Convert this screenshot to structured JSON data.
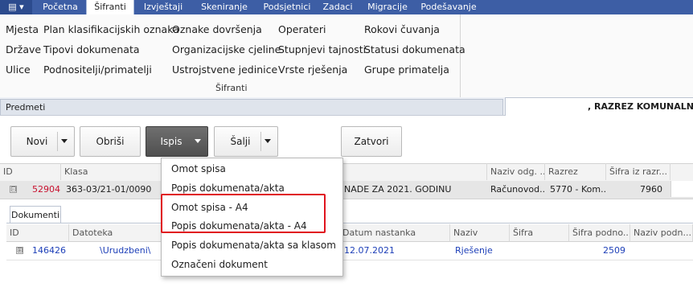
{
  "tabs": [
    {
      "label": "Početna"
    },
    {
      "label": "Šifranti",
      "active": true
    },
    {
      "label": "Izvještaji"
    },
    {
      "label": "Skeniranje"
    },
    {
      "label": "Podsjetnici"
    },
    {
      "label": "Zadaci"
    },
    {
      "label": "Migracije"
    },
    {
      "label": "Podešavanje"
    }
  ],
  "ribbon": {
    "group_label": "Šifranti",
    "col1": [
      "Mjesta",
      "Države",
      "Ulice"
    ],
    "col2": [
      "Plan klasifikacijskih oznaka",
      "Tipovi dokumenata",
      "Podnositelji/primatelji"
    ],
    "col3": [
      "Oznake dovršenja",
      "Organizacijske cjeline",
      "Ustrojstvene jedinice"
    ],
    "col4": [
      "Operateri",
      "Stupnjevi tajnosti",
      "Vrste rješenja"
    ],
    "col5": [
      "Rokovi čuvanja",
      "Statusi dokumenata",
      "Grupe primatelja"
    ]
  },
  "doc_tabs": {
    "predmeti": "Predmeti",
    "razrez": ", RAZREZ KOMUNALNE NA"
  },
  "toolbar": {
    "novi": "Novi",
    "obrisi": "Obriši",
    "ispis": "Ispis",
    "salji": "Šalji",
    "zatvori": "Zatvori"
  },
  "grid": {
    "headers": {
      "id": "ID",
      "klasa": "Klasa",
      "naziv_odg": "Naziv odg. ...",
      "razrez": "Razrez",
      "sifra_iz_razr": "Šifra iz razr..."
    },
    "row": {
      "expander": "⊟",
      "id": "52904",
      "klasa": "363-03/21-01/0090",
      "naziv": "NADE ZA 2021. GODINU",
      "naziv_odg": "Računovod...",
      "razrez": "5770 - Kom...",
      "sifra": "7960"
    }
  },
  "subgrid": {
    "tab": "Dokumenti",
    "headers": {
      "id": "ID",
      "datoteka": "Datoteka",
      "datum": "Datum nastanka",
      "naziv": "Naziv",
      "sifra": "Šifra",
      "sifra_podno": "Šifra podno...",
      "naziv_podn": "Naziv podn..."
    },
    "row": {
      "expander": "⊞",
      "id": "146426",
      "datoteka": "\\Urudzbeni\\",
      "datum": "12.07.2021",
      "naziv": "Rješenje",
      "sifra_podno": "2509"
    }
  },
  "dropdown": {
    "items": [
      "Omot spisa",
      "Popis dokumenata/akta",
      "Omot spisa - A4",
      "Popis dokumenata/akta - A4",
      "Popis dokumenata/akta sa klasom",
      "Označeni dokument"
    ]
  },
  "colors": {
    "tabbar": "#3d5ea5",
    "highlight": "#e0141e",
    "id_red": "#c8102e",
    "link_blue": "#1d3fb8"
  }
}
